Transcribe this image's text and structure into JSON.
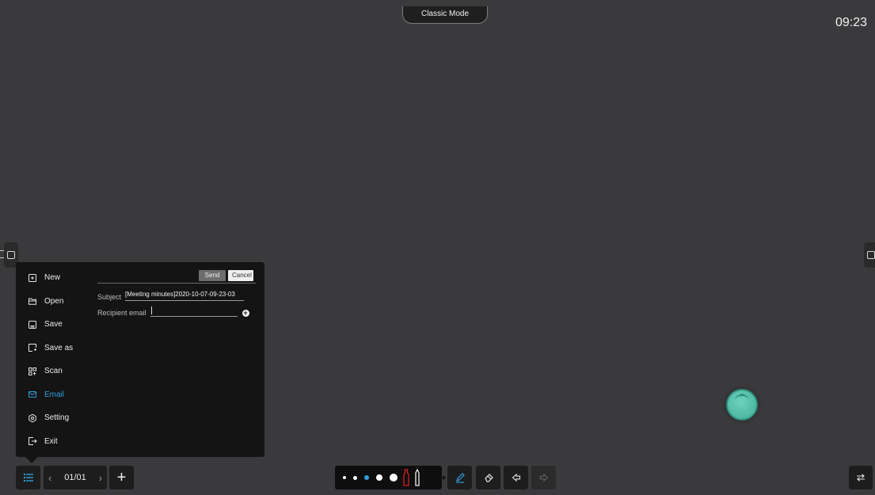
{
  "header": {
    "mode_label": "Classic Mode",
    "clock": "09:23"
  },
  "menu": {
    "items": [
      {
        "label": "New",
        "icon": "new-file-icon"
      },
      {
        "label": "Open",
        "icon": "folder-open-icon"
      },
      {
        "label": "Save",
        "icon": "save-icon"
      },
      {
        "label": "Save as",
        "icon": "save-as-icon"
      },
      {
        "label": "Scan",
        "icon": "scan-icon"
      },
      {
        "label": "Email",
        "icon": "email-icon",
        "active": true
      },
      {
        "label": "Setting",
        "icon": "gear-icon"
      },
      {
        "label": "Exit",
        "icon": "exit-icon"
      }
    ]
  },
  "email_form": {
    "send_label": "Send",
    "cancel_label": "Cancel",
    "subject_label": "Subject",
    "subject_value": "[Meeting minutes]2020-10-07-09-23-03",
    "recipient_label": "Recipient email",
    "recipient_value": ""
  },
  "toolbar": {
    "pager_text": "01/01",
    "add_page_label": "+",
    "pen_sizes": [
      "small",
      "small",
      "medium",
      "large",
      "xlarge"
    ],
    "active_pen_size": 2,
    "accent_color": "#2f9ed8",
    "pen_color": "#d61f1f"
  }
}
